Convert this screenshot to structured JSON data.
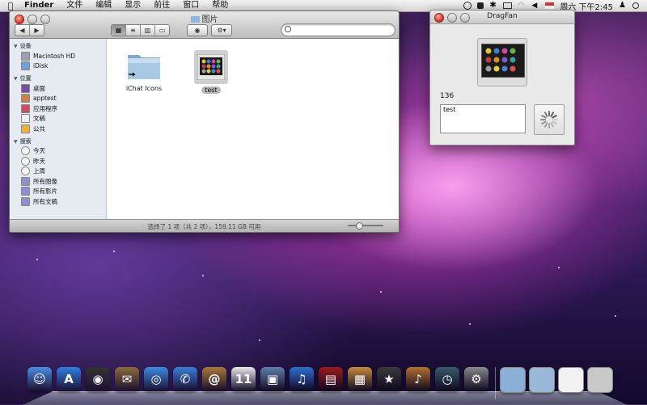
{
  "menubar": {
    "apple_icon": "apple-icon",
    "items": [
      {
        "label": "Finder",
        "app": true
      },
      {
        "label": "文件"
      },
      {
        "label": "编辑"
      },
      {
        "label": "显示"
      },
      {
        "label": "前往"
      },
      {
        "label": "窗口"
      },
      {
        "label": "帮助"
      }
    ],
    "status_icons": [
      "time-machine-icon",
      "dropbox-icon",
      "bluetooth-icon",
      "display-icon",
      "wifi-icon",
      "volume-icon",
      "flag-icon"
    ],
    "clock": "周六 下午2:45",
    "user_icon": "user-icon",
    "spotlight_icon": "spotlight-icon"
  },
  "finder": {
    "title": "图片",
    "toolbar": {
      "back_icon": "back-arrow-icon",
      "forward_icon": "forward-arrow-icon",
      "view_modes": [
        "icon-view",
        "list-view",
        "column-view",
        "coverflow-view"
      ],
      "active_view": "icon-view",
      "quicklook_icon": "eye-icon",
      "action_icon": "gear-icon",
      "search_placeholder": ""
    },
    "sidebar": {
      "sections": [
        {
          "header": "设备",
          "items": [
            {
              "label": "Macintosh HD",
              "icon": "harddisk-icon",
              "color": "#9aa3ad"
            },
            {
              "label": "iDisk",
              "icon": "idisk-icon",
              "color": "#6fa0d8"
            }
          ]
        },
        {
          "header": "位置",
          "items": [
            {
              "label": "桌面",
              "icon": "desktop-icon",
              "color": "#7b4ea6"
            },
            {
              "label": "apptest",
              "icon": "home-icon",
              "color": "#c9834a"
            },
            {
              "label": "应用程序",
              "icon": "applications-icon",
              "color": "#cf4a63"
            },
            {
              "label": "文稿",
              "icon": "documents-icon",
              "color": "#f0f0f0"
            },
            {
              "label": "公共",
              "icon": "public-icon",
              "color": "#e8b33a"
            }
          ]
        },
        {
          "header": "搜索",
          "items": [
            {
              "label": "今天",
              "icon": "clock-icon",
              "color": "#f5f5f5"
            },
            {
              "label": "昨天",
              "icon": "clock-icon",
              "color": "#f5f5f5"
            },
            {
              "label": "上周",
              "icon": "clock-icon",
              "color": "#f5f5f5"
            },
            {
              "label": "所有图像",
              "icon": "smart-folder-icon",
              "color": "#8f8fd0"
            },
            {
              "label": "所有影片",
              "icon": "smart-folder-icon",
              "color": "#8f8fd0"
            },
            {
              "label": "所有文稿",
              "icon": "smart-folder-icon",
              "color": "#8f8fd0"
            }
          ]
        }
      ]
    },
    "files": [
      {
        "name": "iChat Icons",
        "icon": "folder-alias-icon",
        "selected": false
      },
      {
        "name": "test",
        "icon": "image-thumbnail-icon",
        "selected": true
      }
    ],
    "status_text": "选择了 1 项（共 2 项），159.11 GB 可用"
  },
  "dragfan": {
    "title": "DragFan",
    "count": "136",
    "text_value": "test",
    "spinner_icon": "progress-spinner-icon"
  },
  "dock": {
    "apps": [
      {
        "name": "finder-icon",
        "color": "#4a8fe0",
        "glyph": "☺"
      },
      {
        "name": "app-store-icon",
        "color": "#2f7fe0",
        "glyph": "A"
      },
      {
        "name": "dashboard-icon",
        "color": "#333333",
        "glyph": "◉"
      },
      {
        "name": "mail-icon",
        "color": "#8a6a3a",
        "glyph": "✉"
      },
      {
        "name": "safari-icon",
        "color": "#3d8be0",
        "glyph": "◎"
      },
      {
        "name": "ichat-icon",
        "color": "#3a7ed8",
        "glyph": "✆"
      },
      {
        "name": "address-book-icon",
        "color": "#a8793a",
        "glyph": "@"
      },
      {
        "name": "ical-icon",
        "color": "#e9e9e9",
        "glyph": "11"
      },
      {
        "name": "preview-icon",
        "color": "#5f7fa8",
        "glyph": "▣"
      },
      {
        "name": "itunes-icon",
        "color": "#2f6fd0",
        "glyph": "♫"
      },
      {
        "name": "photo-booth-icon",
        "color": "#9a1c1c",
        "glyph": "▤"
      },
      {
        "name": "iphoto-icon",
        "color": "#c58b3a",
        "glyph": "▦"
      },
      {
        "name": "imovie-icon",
        "color": "#3a3a3a",
        "glyph": "★"
      },
      {
        "name": "garageband-icon",
        "color": "#b07030",
        "glyph": "♪"
      },
      {
        "name": "time-machine-icon",
        "color": "#3a5a6a",
        "glyph": "◷"
      },
      {
        "name": "system-preferences-icon",
        "color": "#8a8a8a",
        "glyph": "⚙"
      }
    ],
    "stacks": [
      {
        "name": "applications-stack-icon",
        "color": "#8ab0d8"
      },
      {
        "name": "documents-stack-icon",
        "color": "#9ab8d8"
      },
      {
        "name": "downloads-stack-icon",
        "color": "#f2f2f2"
      },
      {
        "name": "trash-icon",
        "color": "#c8c8c8"
      }
    ]
  }
}
